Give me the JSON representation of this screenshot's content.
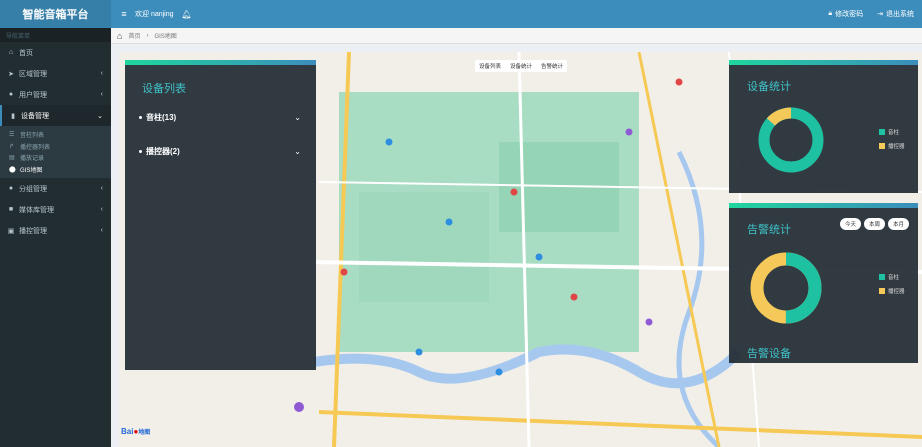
{
  "app": {
    "title": "智能音箱平台"
  },
  "header": {
    "welcome": "欢迎 nanjing",
    "change_password": "修改密码",
    "logout": "退出系统"
  },
  "sidebar": {
    "nav_header": "导航菜单",
    "items": [
      {
        "label": "首页",
        "icon": "home-icon"
      },
      {
        "label": "区域管理",
        "icon": "send-icon"
      },
      {
        "label": "用户管理",
        "icon": "users-icon"
      },
      {
        "label": "设备管理",
        "icon": "device-icon"
      },
      {
        "label": "分组管理",
        "icon": "group-icon"
      },
      {
        "label": "媒体库管理",
        "icon": "media-icon"
      },
      {
        "label": "播控管理",
        "icon": "broadcast-icon"
      }
    ],
    "device_submenu": [
      {
        "label": "音柱列表"
      },
      {
        "label": "播控器列表"
      },
      {
        "label": "播放记录"
      },
      {
        "label": "GIS地图"
      }
    ]
  },
  "breadcrumb": {
    "home": "首页",
    "current": "GIS地图"
  },
  "map_tabs": [
    "设备列表",
    "设备统计",
    "告警统计"
  ],
  "device_list": {
    "title": "设备列表",
    "groups": [
      {
        "label": "音柱(13)"
      },
      {
        "label": "播控器(2)"
      }
    ]
  },
  "device_stats": {
    "title": "设备统计",
    "legend": [
      "音柱",
      "播控器"
    ],
    "values": {
      "音柱": 13,
      "播控器": 2
    },
    "colors": {
      "speaker": "#1ec2a3",
      "controller": "#f5c85a"
    }
  },
  "alarm_stats": {
    "title": "告警统计",
    "buttons": [
      "今天",
      "本周",
      "本月"
    ],
    "legend": [
      "音柱",
      "播控器"
    ],
    "values": {
      "音柱": 50,
      "播控器": 50
    }
  },
  "alarm_devices": {
    "title": "告警设备"
  },
  "map_labels": {
    "baidu": "Bai",
    "baidu_map": "地图"
  }
}
